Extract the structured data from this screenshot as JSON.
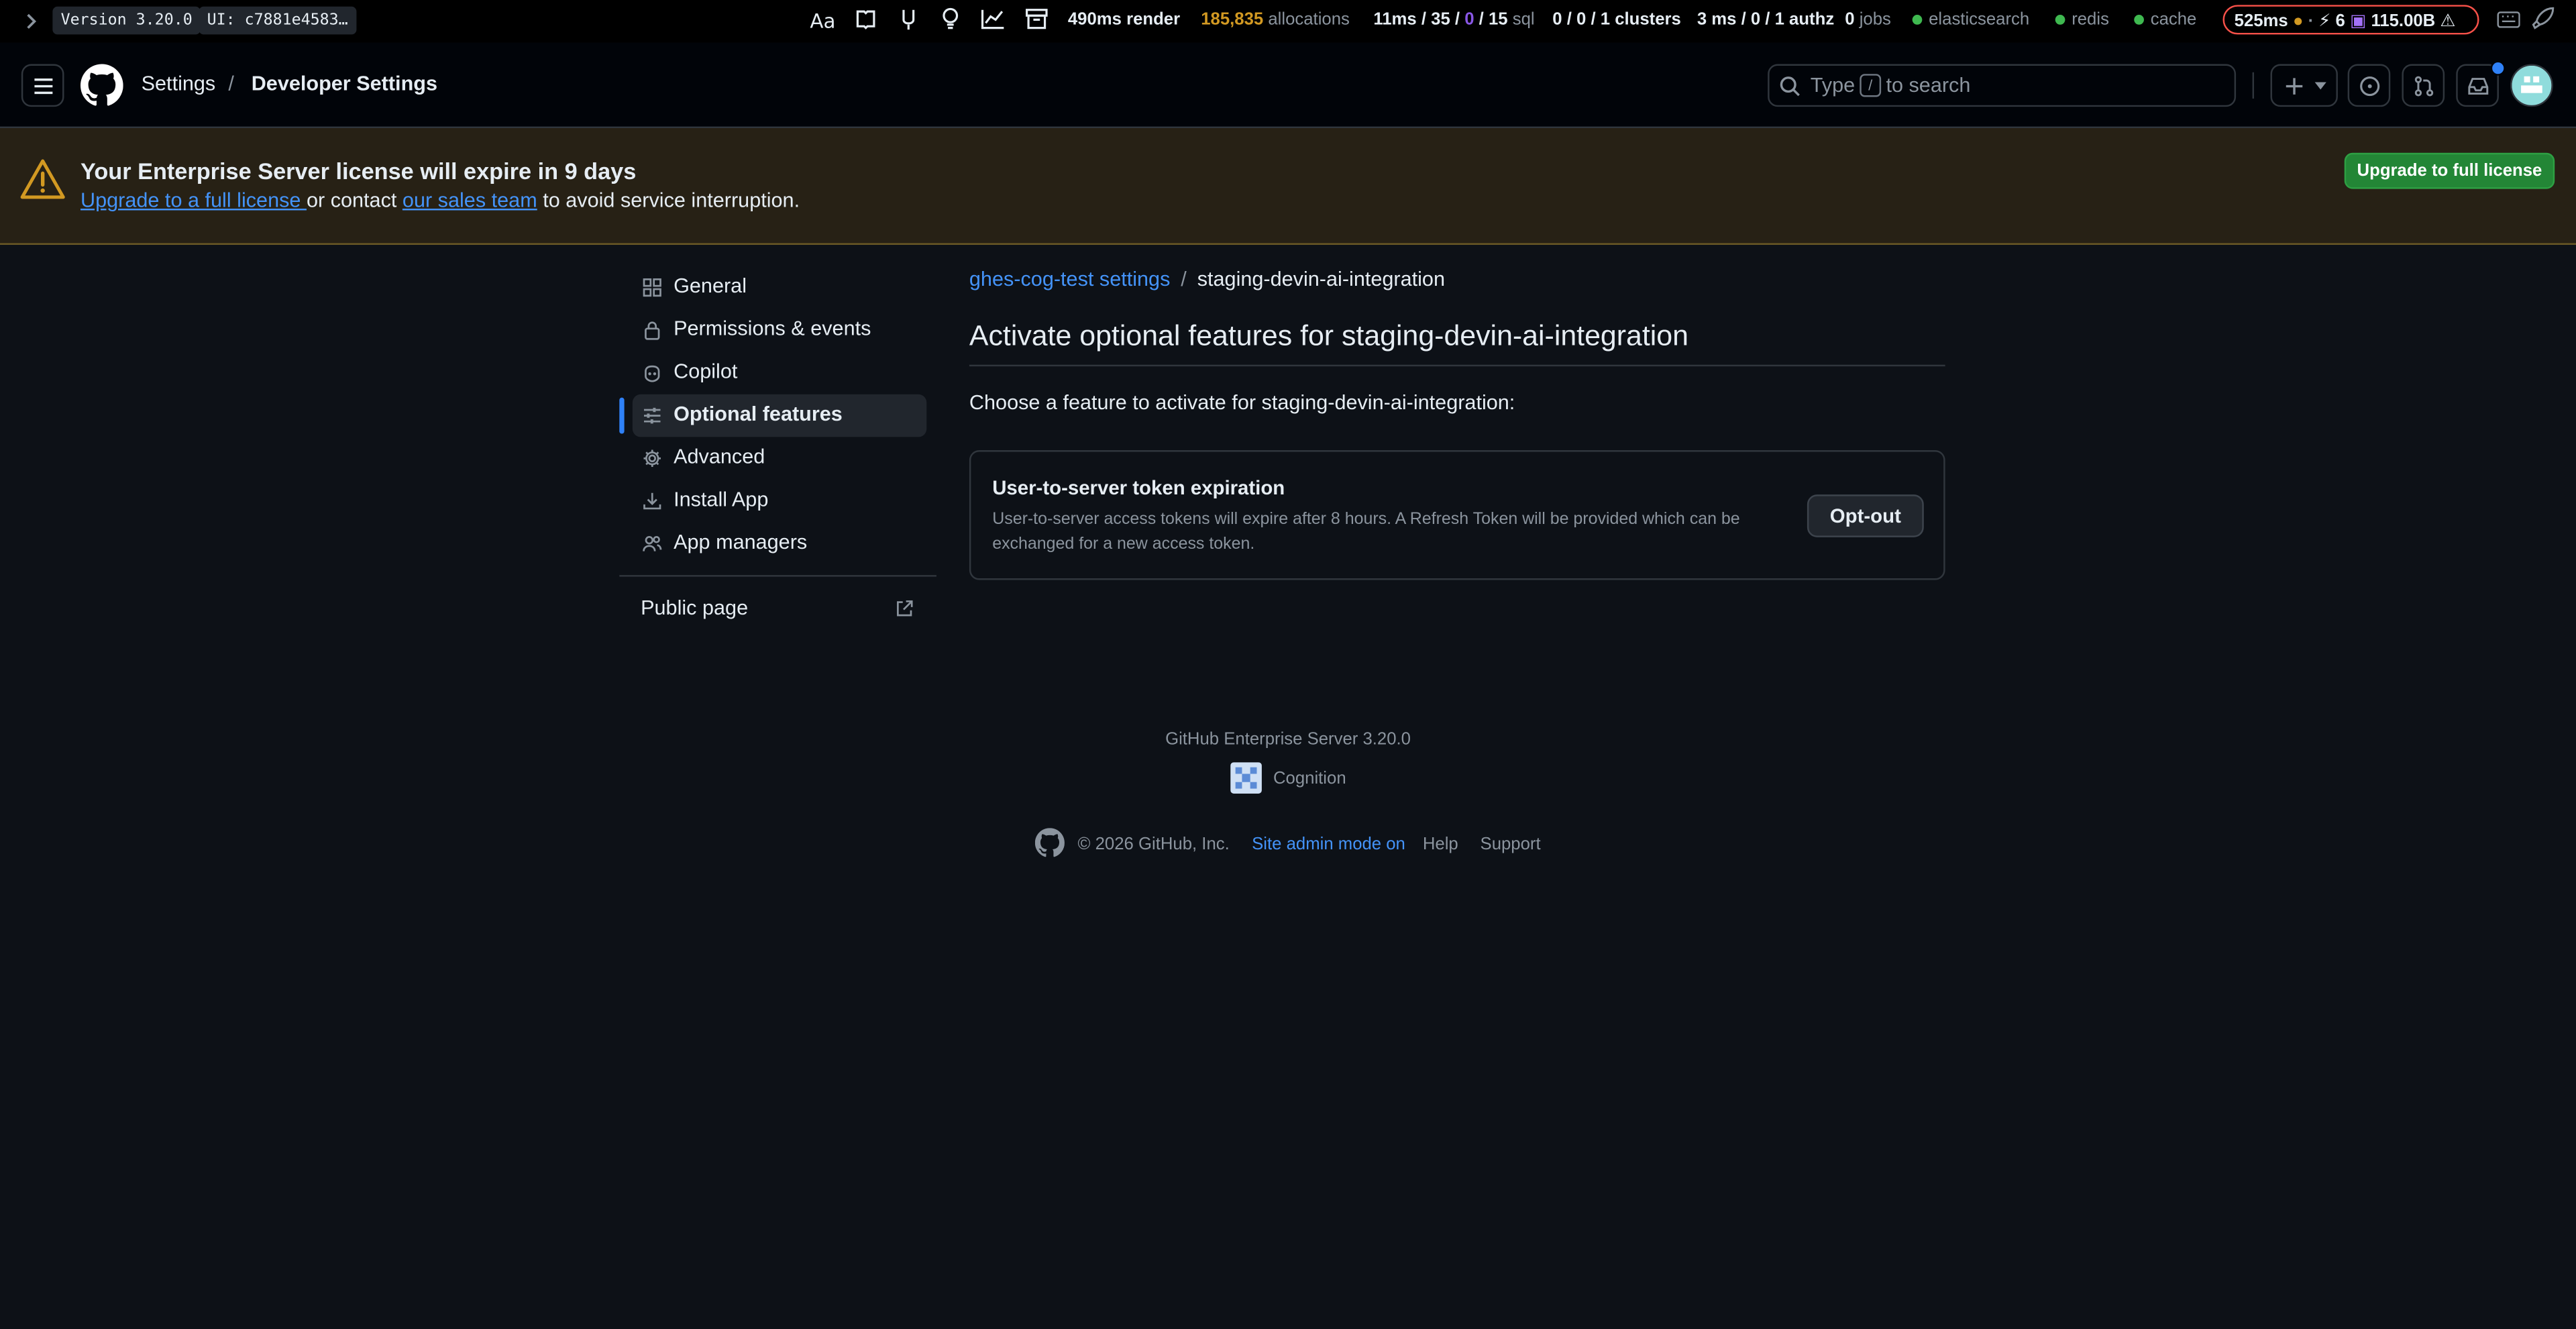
{
  "debugbar": {
    "version": "Version 3.20.0",
    "ui": "UI: c7881e4583…",
    "render": "490ms render",
    "allocations_count": "185,835",
    "allocations_label": "allocations",
    "sql_a": "11ms / 35 /",
    "sql_b": "0",
    "sql_c": "/ 15",
    "sql_label": "sql",
    "clusters": "0 / 0 / 1 clusters",
    "authz": "3 ms / 0 / 1 authz",
    "jobs_count": "0",
    "jobs_label": "jobs",
    "services": [
      "elasticsearch",
      "redis",
      "cache"
    ],
    "perf_time": "525ms",
    "perf_count": "6",
    "perf_mem": "115.00B"
  },
  "header": {
    "crumb_settings": "Settings",
    "crumb_sep": "/",
    "crumb_current": "Developer Settings",
    "search_type": "Type",
    "search_key": "/",
    "search_rest": "to search"
  },
  "banner": {
    "title": "Your Enterprise Server license will expire in 9 days",
    "link1": "Upgrade to a full license ",
    "text_mid": "or contact",
    "link2": "our sales team",
    "text_end": "to avoid service interruption.",
    "button": "Upgrade to full license"
  },
  "sidebar": {
    "items": [
      {
        "label": "General",
        "icon": "apps-icon"
      },
      {
        "label": "Permissions & events",
        "icon": "lock-icon"
      },
      {
        "label": "Copilot",
        "icon": "copilot-icon"
      },
      {
        "label": "Optional features",
        "icon": "sliders-icon"
      },
      {
        "label": "Advanced",
        "icon": "gear-icon"
      },
      {
        "label": "Install App",
        "icon": "download-icon"
      },
      {
        "label": "App managers",
        "icon": "people-icon"
      }
    ],
    "active_index": 3,
    "public_page": "Public page"
  },
  "main": {
    "breadcrumb_link": "ghes-cog-test settings",
    "breadcrumb_sep": "/",
    "breadcrumb_current": "staging-devin-ai-integration",
    "title": "Activate optional features for staging-devin-ai-integration",
    "subtitle": "Choose a feature to activate for staging-devin-ai-integration:",
    "feature": {
      "title": "User-to-server token expiration",
      "desc_line1": "User-to-server access tokens will expire after 8 hours. A Refresh Token will be provided which can be",
      "desc_line2": "exchanged for a new access token.",
      "button": "Opt-out"
    }
  },
  "footer": {
    "version": "GitHub Enterprise Server 3.20.0",
    "org": "Cognition",
    "copyright": "© 2026 GitHub, Inc.",
    "site_admin": "Site admin mode on",
    "help": "Help",
    "support": "Support"
  },
  "colors": {
    "background": "#0d1117",
    "link": "#4493f8",
    "banner_bg": "#272115",
    "warning": "#d29922",
    "primary_button": "#238636",
    "allocations": "#d29922"
  }
}
